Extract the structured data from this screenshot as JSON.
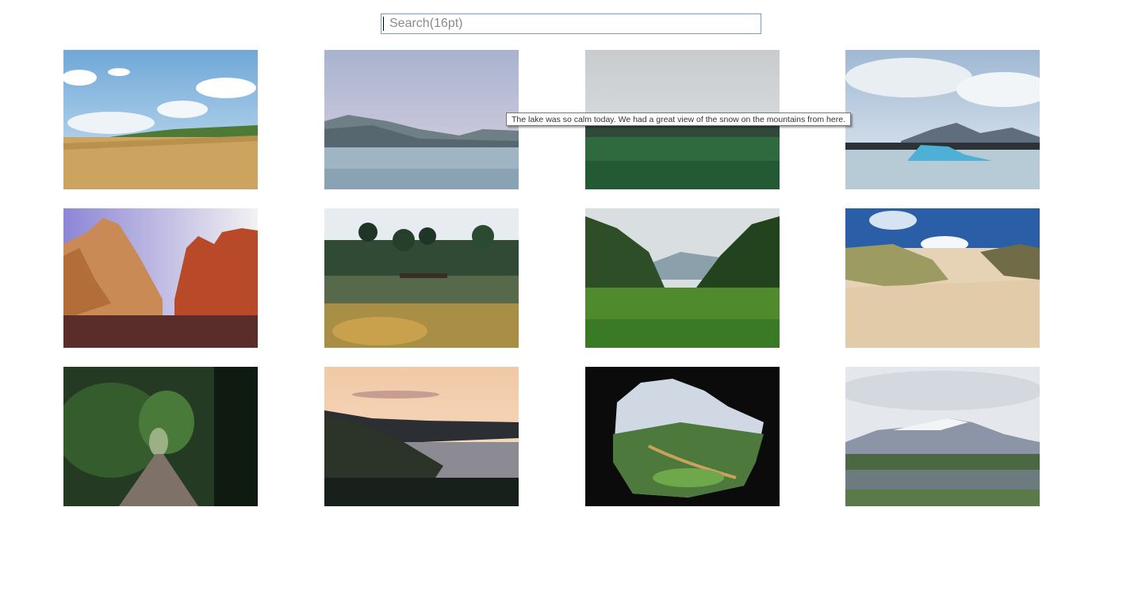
{
  "search": {
    "placeholder": "Search(16pt)",
    "value": ""
  },
  "tooltip": {
    "text": "The lake was so calm today. We had a great view of the snow on the mountains from here."
  },
  "gallery": {
    "images": [
      {
        "subject": "field"
      },
      {
        "subject": "lake"
      },
      {
        "subject": "meadow"
      },
      {
        "subject": "glacier"
      },
      {
        "subject": "canyon"
      },
      {
        "subject": "garden"
      },
      {
        "subject": "valley"
      },
      {
        "subject": "dunes"
      },
      {
        "subject": "path"
      },
      {
        "subject": "coast"
      },
      {
        "subject": "cave"
      },
      {
        "subject": "mountain"
      }
    ]
  }
}
